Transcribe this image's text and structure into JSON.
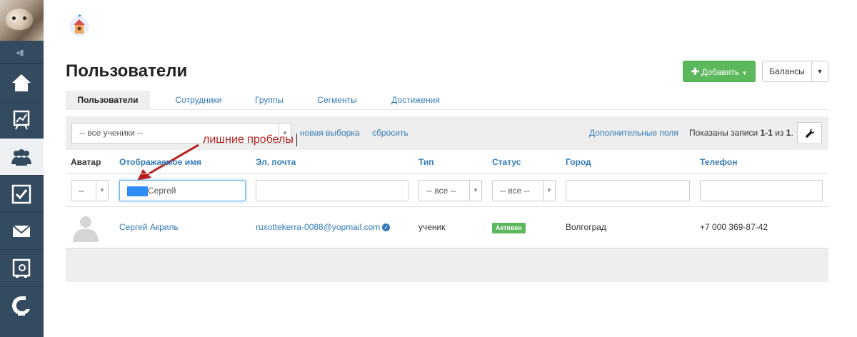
{
  "header": {
    "title": "Пользователи",
    "add_label": "Добавить",
    "balance_label": "Балансы"
  },
  "tabs": [
    {
      "label": "Пользователи",
      "active": true
    },
    {
      "label": "Сотрудники",
      "active": false
    },
    {
      "label": "Группы",
      "active": false
    },
    {
      "label": "Сегменты",
      "active": false
    },
    {
      "label": "Достижения",
      "active": false
    }
  ],
  "filter_bar": {
    "students_select": "-- все ученики --",
    "new_selection_label": "новая выборка",
    "reset_label": "сбросить",
    "extra_fields_label": "Дополнительные поля",
    "records_prefix": "Показаны записи ",
    "records_range": "1-1",
    "records_of": " из ",
    "records_total": "1",
    "records_suffix": "."
  },
  "annotation": {
    "text": "лишние пробелы",
    "color": "#b81d1d"
  },
  "table": {
    "columns": [
      "Аватар",
      "Отображаемое имя",
      "Эл. почта",
      "Тип",
      "Статус",
      "Город",
      "Телефон"
    ],
    "filters": {
      "avatar": "--",
      "name": "Сергей",
      "email": "",
      "type": "-- все --",
      "status": "-- все --",
      "city": "",
      "phone": ""
    },
    "rows": [
      {
        "name": "Сергей Акриль",
        "email": "ruxottekerra-0088@yopmail.com",
        "type": "ученик",
        "status": "Активен",
        "city": "Волгоград",
        "phone": "+7 000 369-87-42"
      }
    ]
  },
  "sidebar": {
    "items": [
      {
        "icon": "home-icon",
        "active": false
      },
      {
        "icon": "chart-icon",
        "active": false
      },
      {
        "icon": "users-icon",
        "active": true
      },
      {
        "icon": "tasks-icon",
        "active": false
      },
      {
        "icon": "mail-icon",
        "active": false
      },
      {
        "icon": "safe-icon",
        "active": false
      },
      {
        "icon": "brand-icon",
        "active": false
      }
    ]
  },
  "colors": {
    "sidebar_bg": "#344a5f",
    "accent_link": "#337ab7",
    "success": "#5cb85c",
    "annotation": "#b81d1d"
  }
}
